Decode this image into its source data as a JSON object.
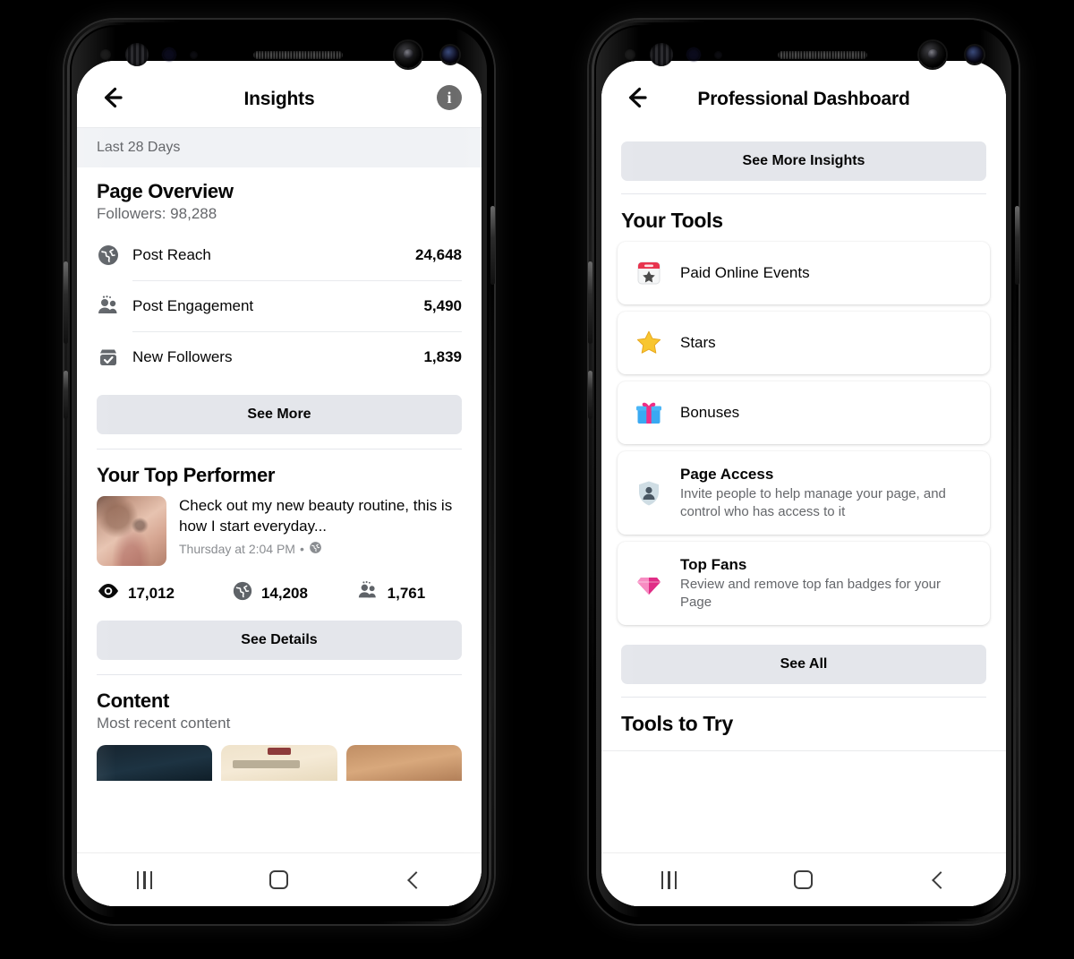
{
  "phones": {
    "left": {
      "header": {
        "title": "Insights",
        "back_icon": "back-arrow-icon",
        "info_icon": "info-icon"
      },
      "date_filter": "Last 28 Days",
      "page_overview": {
        "title": "Page Overview",
        "followers": "Followers: 98,288",
        "stats": [
          {
            "icon": "globe-icon",
            "label": "Post Reach",
            "value": "24,648"
          },
          {
            "icon": "people-icon",
            "label": "Post Engagement",
            "value": "5,490"
          },
          {
            "icon": "check-badge-icon",
            "label": "New Followers",
            "value": "1,839"
          }
        ],
        "see_more_label": "See More"
      },
      "top_performer": {
        "title": "Your Top Performer",
        "post_text": "Check out my new beauty routine, this is how I start everyday...",
        "post_time": "Thursday at 2:04 PM",
        "privacy_icon": "globe-icon",
        "metrics": [
          {
            "icon": "eye-icon",
            "value": "17,012"
          },
          {
            "icon": "globe-icon",
            "value": "14,208"
          },
          {
            "icon": "people-icon",
            "value": "1,761"
          }
        ],
        "see_details_label": "See Details"
      },
      "content": {
        "title": "Content",
        "subtitle": "Most recent content",
        "thumbnails": [
          "dark-navy-thumbnail",
          "cream-text-thumbnail",
          "tan-photo-thumbnail"
        ]
      },
      "navbar": {
        "recents": "recents-icon",
        "home": "home-icon",
        "back": "back-icon"
      }
    },
    "right": {
      "header": {
        "title": "Professional Dashboard",
        "back_icon": "back-arrow-icon"
      },
      "see_more_insights_label": "See More Insights",
      "your_tools": {
        "title": "Your Tools",
        "items": [
          {
            "icon": "calendar-star-icon",
            "title": "Paid Online Events",
            "desc": ""
          },
          {
            "icon": "star-icon",
            "title": "Stars",
            "desc": ""
          },
          {
            "icon": "gift-icon",
            "title": "Bonuses",
            "desc": ""
          },
          {
            "icon": "shield-person-icon",
            "title": "Page Access",
            "desc": "Invite people to help manage your page, and control who has access to it"
          },
          {
            "icon": "gem-icon",
            "title": "Top Fans",
            "desc": "Review and remove top fan badges for your Page"
          }
        ],
        "see_all_label": "See All"
      },
      "tools_to_try": {
        "title": "Tools to Try"
      },
      "navbar": {
        "recents": "recents-icon",
        "home": "home-icon",
        "back": "back-icon"
      }
    }
  },
  "colors": {
    "background": "#000000",
    "surface": "#ffffff",
    "grey_band": "#f0f2f5",
    "button_grey": "#e4e6eb",
    "text_primary": "#050505",
    "text_secondary": "#65676b",
    "accent_red": "#e83e5a",
    "accent_yellow": "#f7b928",
    "accent_pink": "#f0368c",
    "accent_blue": "#3ba9f4"
  }
}
